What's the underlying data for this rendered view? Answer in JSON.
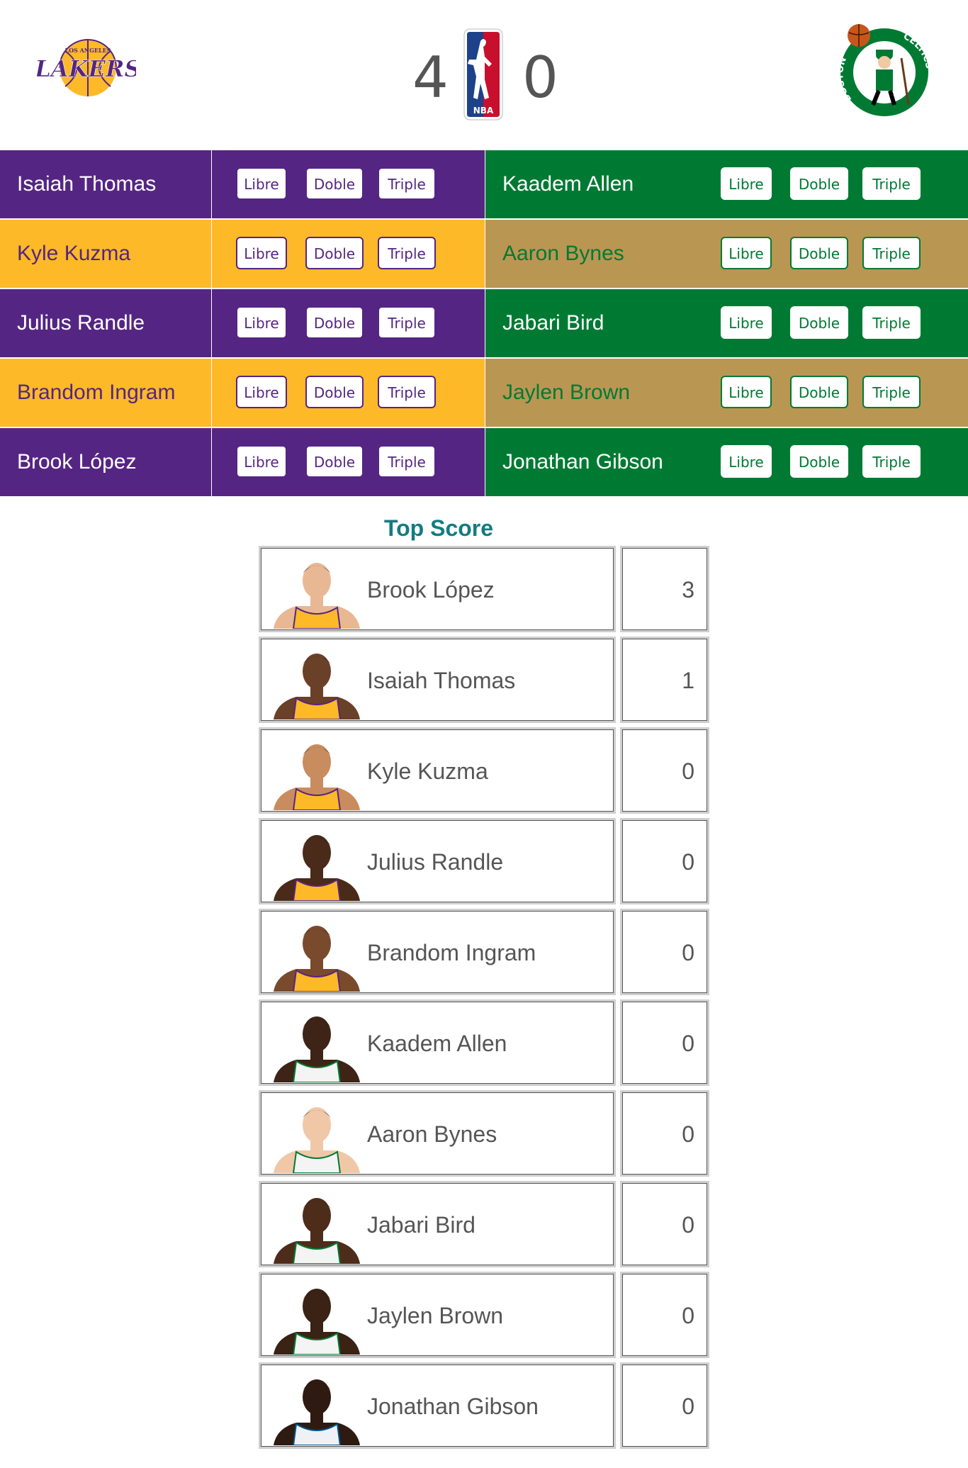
{
  "header": {
    "home_team_logo": "lakers-logo",
    "away_team_logo": "celtics-logo",
    "league_logo": "nba-logo",
    "home_score": "4",
    "away_score": "0",
    "lakers_logo_text_top": "LOS ANGELES",
    "lakers_logo_text": "LAKERS",
    "celtics_logo_text_left": "BOSTON",
    "celtics_logo_text_right": "CELTICS",
    "nba_logo_text": "NBA"
  },
  "buttons": {
    "free": "Libre",
    "double": "Doble",
    "triple": "Triple"
  },
  "teams": {
    "home": {
      "colors": {
        "primary": "#552583",
        "secondary": "#FDB927"
      },
      "players": [
        "Isaiah Thomas",
        "Kyle Kuzma",
        "Julius Randle",
        "Brandom Ingram",
        "Brook López"
      ]
    },
    "away": {
      "colors": {
        "primary": "#007A33",
        "secondary": "#BA9653"
      },
      "players": [
        "Kaadem Allen",
        "Aaron Bynes",
        "Jabari Bird",
        "Jaylen Brown",
        "Jonathan Gibson"
      ]
    }
  },
  "top_score": {
    "title": "Top Score",
    "title_color": "#137c80",
    "rows": [
      {
        "name": "Brook López",
        "points": "3",
        "jersey": "lakers"
      },
      {
        "name": "Isaiah Thomas",
        "points": "1",
        "jersey": "lakers"
      },
      {
        "name": "Kyle Kuzma",
        "points": "0",
        "jersey": "lakers"
      },
      {
        "name": "Julius Randle",
        "points": "0",
        "jersey": "lakers"
      },
      {
        "name": "Brandom Ingram",
        "points": "0",
        "jersey": "lakers"
      },
      {
        "name": "Kaadem Allen",
        "points": "0",
        "jersey": "celtics"
      },
      {
        "name": "Aaron Bynes",
        "points": "0",
        "jersey": "celtics"
      },
      {
        "name": "Jabari Bird",
        "points": "0",
        "jersey": "celtics"
      },
      {
        "name": "Jaylen Brown",
        "points": "0",
        "jersey": "celtics"
      },
      {
        "name": "Jonathan Gibson",
        "points": "0",
        "jersey": "mavs"
      }
    ]
  }
}
